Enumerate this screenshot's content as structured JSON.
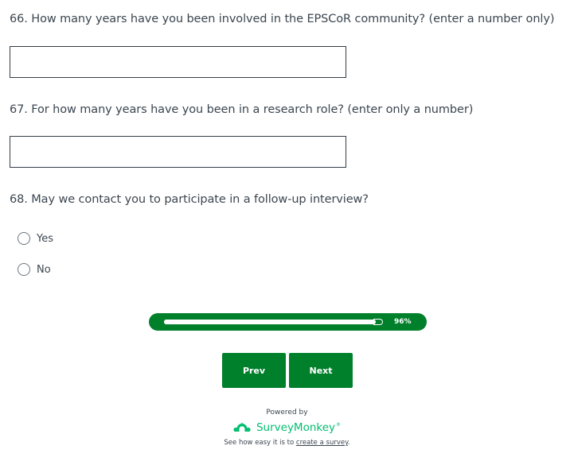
{
  "questions": [
    {
      "number": "66.",
      "text": "66. How many years have you been involved in the EPSCoR community? (enter a number only)",
      "type": "text",
      "value": "",
      "placeholder": ""
    },
    {
      "number": "67.",
      "text": "67. For how many years have you been in a research role? (enter only a number)",
      "type": "text",
      "value": "",
      "placeholder": ""
    },
    {
      "number": "68.",
      "text": "68. May we contact you to participate in a follow-up interview?",
      "type": "radio",
      "options": [
        "Yes",
        "No"
      ],
      "selected": null
    }
  ],
  "progress": {
    "percent": 96,
    "label": "96%"
  },
  "navigation": {
    "prev_label": "Prev",
    "next_label": "Next"
  },
  "footer": {
    "powered_by": "Powered by",
    "brand_name": "SurveyMonkey",
    "brand_tm": "®",
    "tagline_prefix": "See how easy it is to ",
    "tagline_link": "create a survey",
    "tagline_suffix": "."
  },
  "colors": {
    "accent": "#00802b",
    "brand": "#00bf6f",
    "text": "#3b4650",
    "input_border": "#333e48"
  },
  "icons": {
    "brand_logo": "surveymonkey-logo-icon",
    "radio": "radio-unchecked-icon"
  }
}
